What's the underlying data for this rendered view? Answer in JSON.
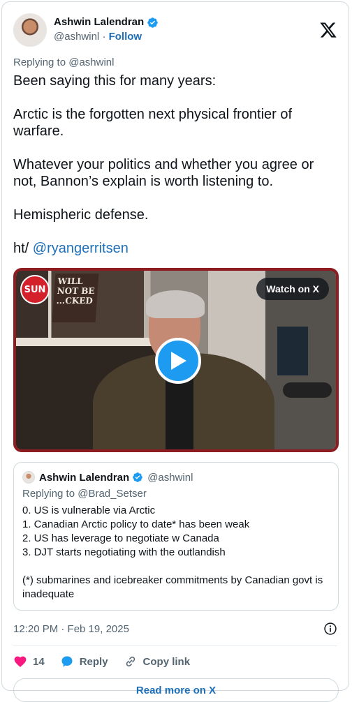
{
  "author": {
    "name": "Ashwin Lalendran",
    "handle": "@ashwinl",
    "follow_label": "Follow",
    "separator": "·"
  },
  "tweet": {
    "replying_to": "Replying to @ashwinl",
    "paragraphs": [
      "Been saying this for many years:",
      "Arctic is the forgotten next physical frontier of warfare.",
      "Whatever your politics and whether you agree or not, Bannon’s explain is worth listening to.",
      "Hemispheric defense."
    ],
    "ht_prefix": "ht/ ",
    "ht_mention": "@ryangerritsen"
  },
  "media": {
    "watch_label": "Watch on X",
    "badge_text": "SUN",
    "sign_text": "WILL NOT BE ...CKED"
  },
  "quote": {
    "name": "Ashwin Lalendran",
    "handle": "@ashwinl",
    "replying_to": "Replying to @Brad_Setser",
    "lines": [
      "0. US is vulnerable via Arctic",
      "1. Canadian Arctic policy to date* has been weak",
      "2. US has leverage to negotiate w Canada",
      "3. DJT starts negotiating with the outlandish",
      "",
      "(*) submarines and icebreaker commitments by Canadian govt is inadequate"
    ]
  },
  "meta": {
    "timestamp": "12:20 PM · Feb 19, 2025"
  },
  "actions": {
    "like_count": "14",
    "reply_label": "Reply",
    "copy_link_label": "Copy link"
  },
  "read_more_label": "Read more on X",
  "colors": {
    "link": "#1d6fb8",
    "like": "#f91880",
    "verified": "#1d9bf0",
    "secondary_text": "#536471"
  }
}
